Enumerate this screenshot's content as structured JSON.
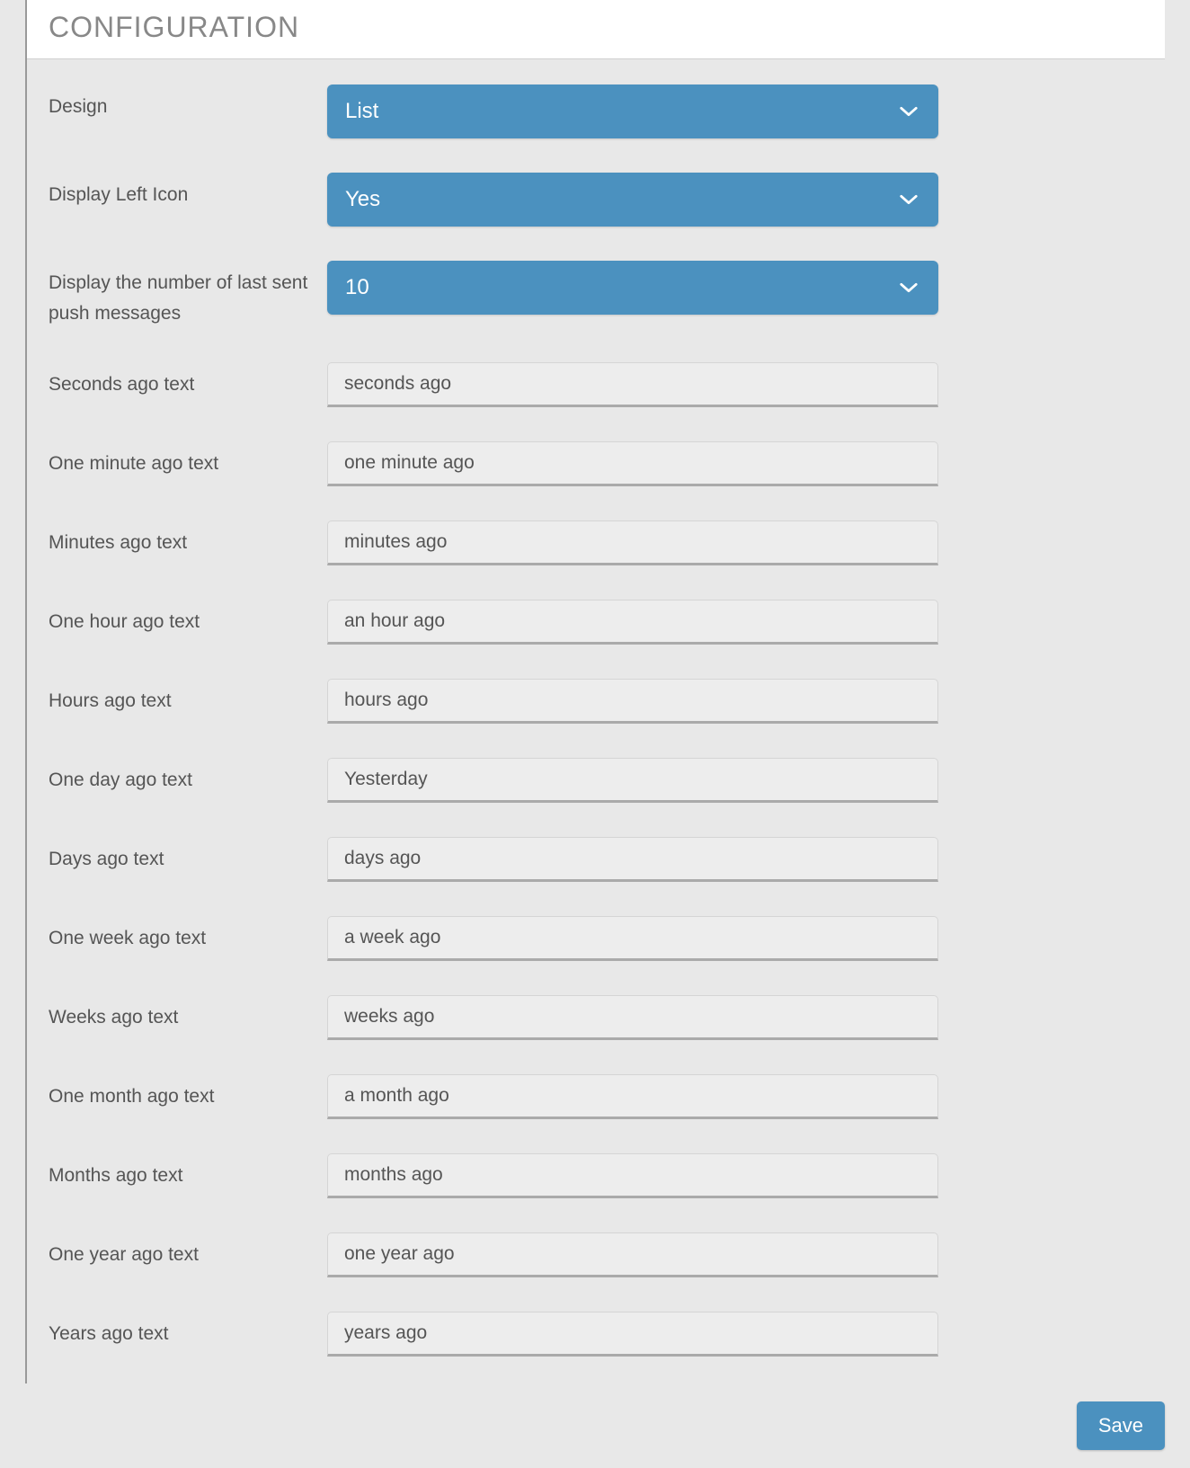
{
  "panel": {
    "title": "CONFIGURATION"
  },
  "fields": {
    "design": {
      "label": "Design",
      "value": "List"
    },
    "display_left_icon": {
      "label": "Display Left Icon",
      "value": "Yes"
    },
    "display_number": {
      "label": "Display the number of last sent push messages",
      "value": "10"
    },
    "seconds_ago": {
      "label": "Seconds ago text",
      "value": "seconds ago"
    },
    "one_minute_ago": {
      "label": "One minute ago text",
      "value": "one minute ago"
    },
    "minutes_ago": {
      "label": "Minutes ago text",
      "value": "minutes ago"
    },
    "one_hour_ago": {
      "label": "One hour ago text",
      "value": "an hour ago"
    },
    "hours_ago": {
      "label": "Hours ago text",
      "value": "hours ago"
    },
    "one_day_ago": {
      "label": "One day ago text",
      "value": "Yesterday"
    },
    "days_ago": {
      "label": "Days ago text",
      "value": "days ago"
    },
    "one_week_ago": {
      "label": "One week ago text",
      "value": "a week ago"
    },
    "weeks_ago": {
      "label": "Weeks ago text",
      "value": "weeks ago"
    },
    "one_month_ago": {
      "label": "One month ago text",
      "value": "a month ago"
    },
    "months_ago": {
      "label": "Months ago text",
      "value": "months ago"
    },
    "one_year_ago": {
      "label": "One year ago text",
      "value": "one year ago"
    },
    "years_ago": {
      "label": "Years ago text",
      "value": "years ago"
    }
  },
  "actions": {
    "save": "Save"
  },
  "colors": {
    "accent": "#4b91bf",
    "bg": "#e8e8e8",
    "input_bg": "#ededed"
  }
}
